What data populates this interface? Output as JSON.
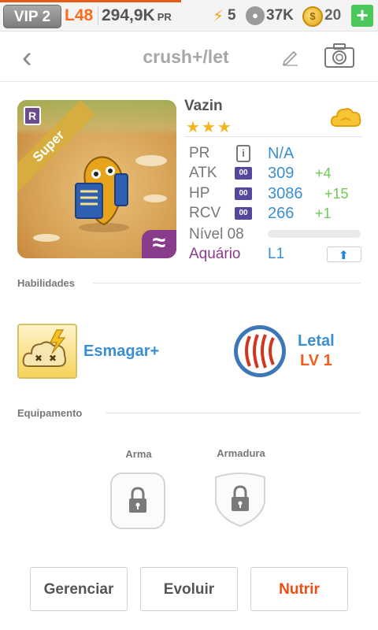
{
  "statusbar": {
    "vip": "VIP 2",
    "level": "L48",
    "pr_value": "294,9K",
    "pr_unit": "PR",
    "energy": "5",
    "food": "37K",
    "coins": "20",
    "add_label": "+"
  },
  "header": {
    "title": "crush+/let"
  },
  "monster": {
    "name": "Vazin",
    "stars": "★★★",
    "rarity_letter": "R",
    "ribbon": "Super",
    "element_symbol": "≈",
    "stats": {
      "pr": {
        "label": "PR",
        "value": "N/A"
      },
      "atk": {
        "label": "ATK",
        "badge": "00",
        "value": "309",
        "bonus": "+4"
      },
      "hp": {
        "label": "HP",
        "badge": "00",
        "value": "3086",
        "bonus": "+15"
      },
      "rcv": {
        "label": "RCV",
        "badge": "00",
        "value": "266",
        "bonus": "+1"
      }
    },
    "level_label": "Nível 08",
    "level_progress": 0,
    "element_name": "Aquário",
    "element_level": "L1"
  },
  "skills_section": {
    "title": "Habilidades",
    "active_name": "Esmagar+",
    "passive_name": "Letal",
    "passive_level": "LV 1"
  },
  "equipment_section": {
    "title": "Equipamento",
    "weapon_label": "Arma",
    "armor_label": "Armadura"
  },
  "buttons": {
    "manage": "Gerenciar",
    "evolve": "Evoluir",
    "feed": "Nutrir"
  },
  "colors": {
    "accent_orange": "#ee4e12",
    "stat_blue": "#3a8fd3",
    "bonus_green": "#6ecb54",
    "element_purple": "#8d3a8c"
  }
}
